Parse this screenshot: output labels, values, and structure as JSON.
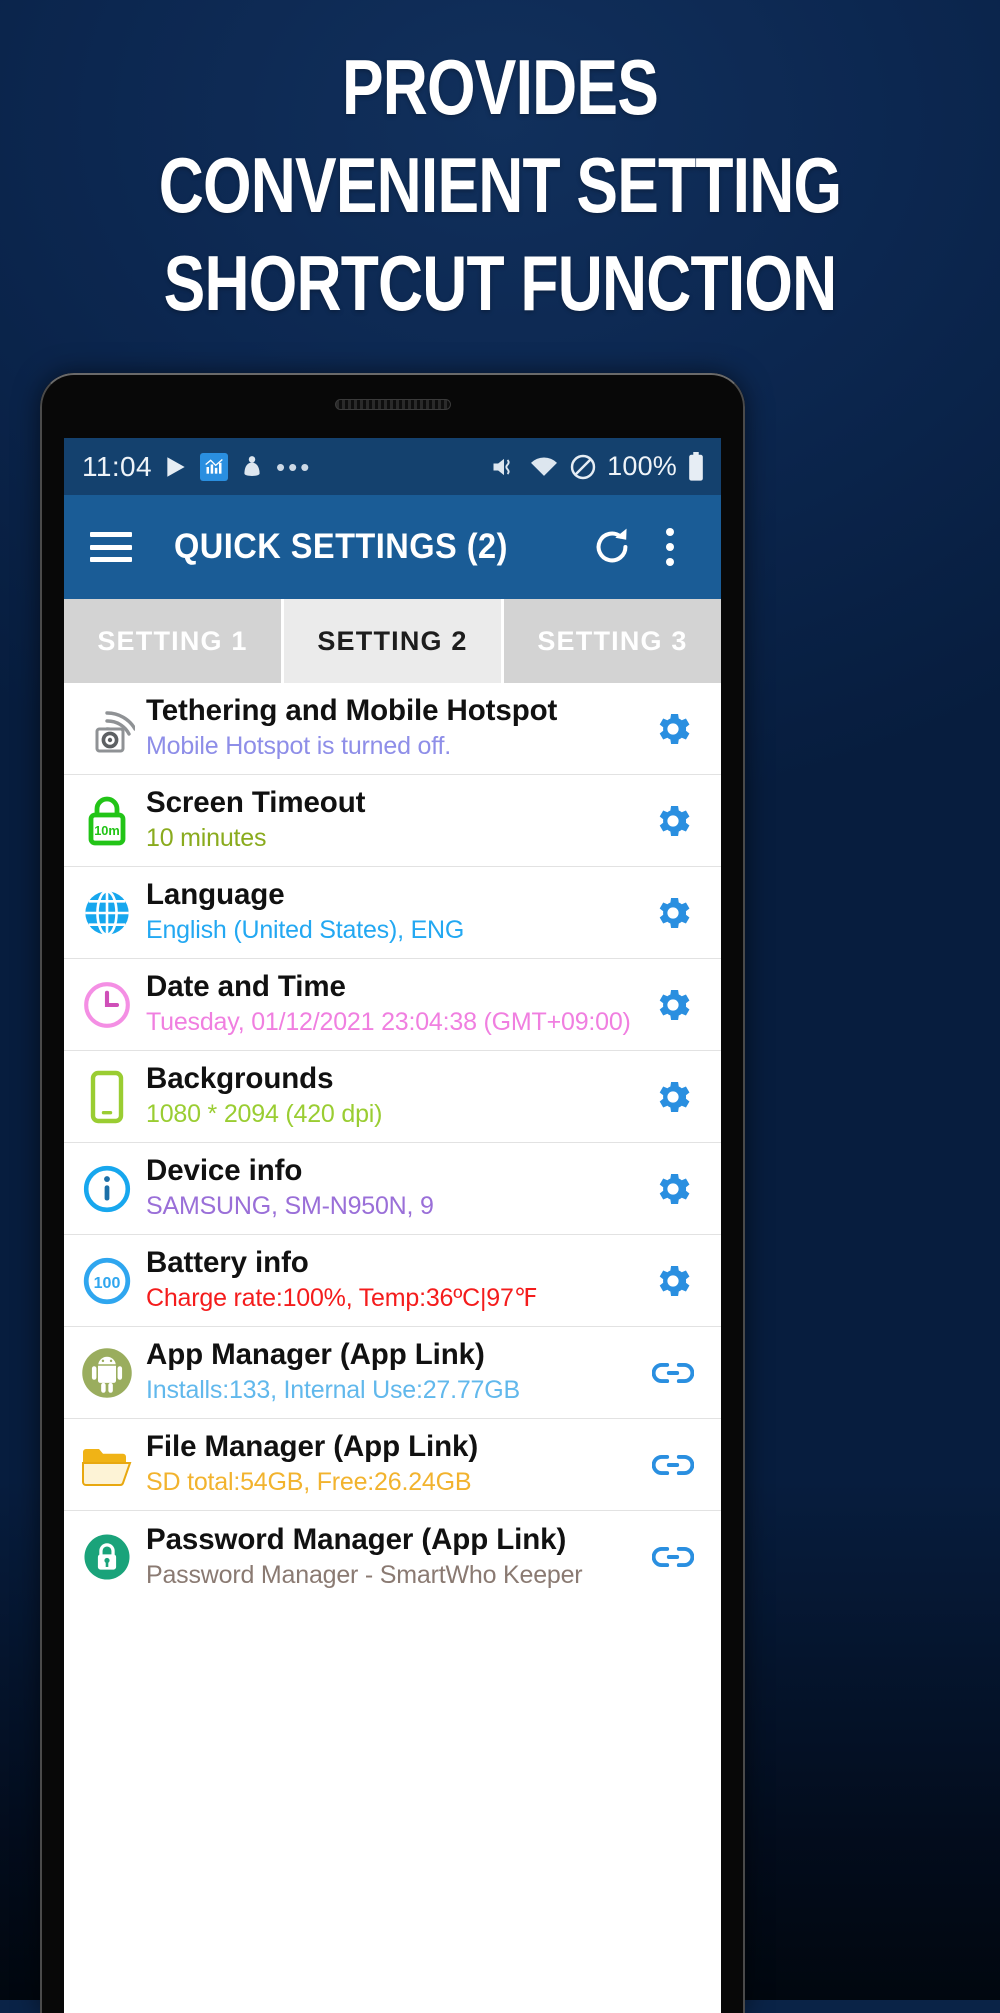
{
  "promo": {
    "headline_lines": [
      "PROVIDES",
      "CONVENIENT SETTING",
      "SHORTCUT FUNCTION"
    ],
    "background_color": "#0a2347",
    "headline_color": "#ffffff"
  },
  "status_bar": {
    "time": "11:04",
    "left_icons": [
      "play-store-icon",
      "chart-app-icon",
      "download-manager-icon",
      "more-notifications-icon"
    ],
    "right_icons": [
      "mute-vibrate-icon",
      "wifi-icon",
      "do-not-disturb-icon"
    ],
    "battery_percent": "100%",
    "battery_icon": "battery-full-icon",
    "background_color": "#14416e"
  },
  "app_bar": {
    "menu_icon": "hamburger-menu-icon",
    "title": "QUICK SETTINGS (2)",
    "refresh_icon": "refresh-icon",
    "overflow_icon": "kebab-menu-icon",
    "background_color": "#1a5c96"
  },
  "tabs": [
    {
      "label": "SETTING 1",
      "active": false
    },
    {
      "label": "SETTING 2",
      "active": true
    },
    {
      "label": "SETTING 3",
      "active": false
    }
  ],
  "settings_list": [
    {
      "icon": "wifi-hotspot-icon",
      "title": "Tethering and Mobile Hotspot",
      "subtitle": "Mobile Hotspot is turned off.",
      "subtitle_color": "#8e8ee8",
      "action": "gear-icon"
    },
    {
      "icon": "lock-timeout-icon",
      "title": "Screen Timeout",
      "subtitle": "10 minutes",
      "subtitle_color": "#8aab1e",
      "action": "gear-icon"
    },
    {
      "icon": "globe-icon",
      "title": "Language",
      "subtitle": "English (United States), ENG",
      "subtitle_color": "#23a8f2",
      "action": "gear-icon"
    },
    {
      "icon": "clock-icon",
      "title": "Date and Time",
      "subtitle": "Tuesday,  01/12/2021 23:04:38  (GMT+09:00)",
      "subtitle_color": "#f07fe0",
      "action": "gear-icon"
    },
    {
      "icon": "phone-screen-icon",
      "title": "Backgrounds",
      "subtitle": "1080 * 2094  (420 dpi)",
      "subtitle_color": "#9acd32",
      "action": "gear-icon"
    },
    {
      "icon": "info-circle-icon",
      "title": "Device info",
      "subtitle": "SAMSUNG, SM-N950N, 9",
      "subtitle_color": "#9a6fd8",
      "action": "gear-icon"
    },
    {
      "icon": "battery-100-icon",
      "title": "Battery info",
      "subtitle": "Charge rate:100%, Temp:36ºC|97℉",
      "subtitle_color": "#f41c1c",
      "action": "gear-icon"
    },
    {
      "icon": "android-robot-icon",
      "title": "App Manager (App Link)",
      "subtitle": "Installs:133, Internal Use:27.77GB",
      "subtitle_color": "#61b8ec",
      "action": "link-icon"
    },
    {
      "icon": "folder-icon",
      "title": "File Manager (App Link)",
      "subtitle": "SD total:54GB, Free:26.24GB",
      "subtitle_color": "#f2b32e",
      "action": "link-icon"
    },
    {
      "icon": "padlock-green-icon",
      "title": "Password Manager (App Link)",
      "subtitle": "Password Manager - SmartWho Keeper",
      "subtitle_color": "#8a7a72",
      "action": "link-icon"
    }
  ],
  "theme": {
    "accent_blue": "#2a8fe0",
    "tab_active_bg": "#ebebeb",
    "tab_inactive_bg": "#d3d3d3"
  }
}
